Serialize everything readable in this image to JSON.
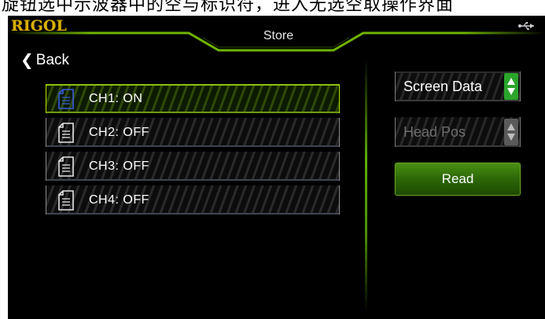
{
  "caption": "旋钮选中示波器中的空与标识符，进入无选空取操作界面",
  "header": {
    "brand": "RIGOL",
    "title": "Store",
    "usb_icon": "usb-icon"
  },
  "nav": {
    "back_label": "Back"
  },
  "channels": [
    {
      "label": "CH1:  ON",
      "selected": true
    },
    {
      "label": "CH2:  OFF",
      "selected": false
    },
    {
      "label": "CH3:  OFF",
      "selected": false
    },
    {
      "label": "CH4:  OFF",
      "selected": false
    }
  ],
  "panel": {
    "storage_type": "Screen Data",
    "position": "Head Pos",
    "read_label": "Read"
  },
  "colors": {
    "brand": "#d9b000",
    "accent": "#7dbb00",
    "selected_icon": "#3a5bd9",
    "spinner_active": "#2aa52a"
  }
}
